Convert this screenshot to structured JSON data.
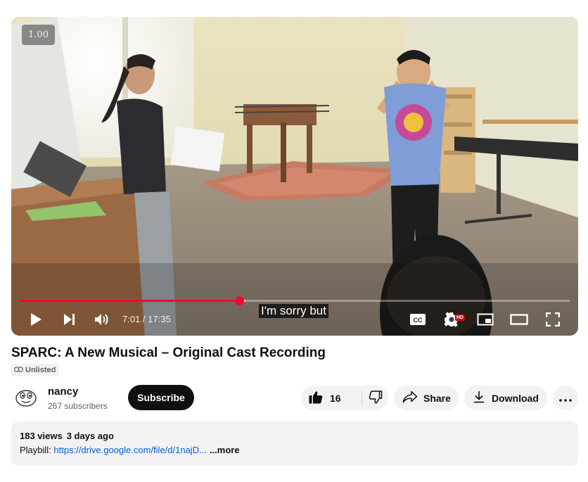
{
  "player": {
    "speed_badge": "1.00",
    "current_time": "7:01",
    "duration": "17:35",
    "time_separator": " / ",
    "progress_fraction": 0.3991,
    "buffered_fraction": 0.41,
    "caption_text": "I'm sorry but",
    "hd_badge": "HD",
    "progress_color": "#ff0033"
  },
  "video": {
    "title": "SPARC: A New Musical – Original Cast Recording",
    "visibility_label": "Unlisted"
  },
  "channel": {
    "name": "nancy",
    "subscribers": "267 subscribers",
    "subscribe_label": "Subscribe"
  },
  "actions": {
    "like_count": "16",
    "share_label": "Share",
    "download_label": "Download"
  },
  "description": {
    "views": "183 views",
    "age": "3 days ago",
    "prefix": "Playbill: ",
    "link_text": "https://drive.google.com/file/d/1najD...",
    "more_label": "...more"
  },
  "icons": {
    "play": "play-icon",
    "next": "next-icon",
    "volume": "volume-icon",
    "captions": "captions-icon",
    "settings": "settings-icon",
    "miniplayer": "miniplayer-icon",
    "theater": "theater-mode-icon",
    "fullscreen": "fullscreen-icon",
    "like": "thumbs-up-icon",
    "dislike": "thumbs-down-icon",
    "share": "share-arrow-icon",
    "download": "download-icon",
    "more": "more-horizontal-icon",
    "link": "link-icon"
  }
}
